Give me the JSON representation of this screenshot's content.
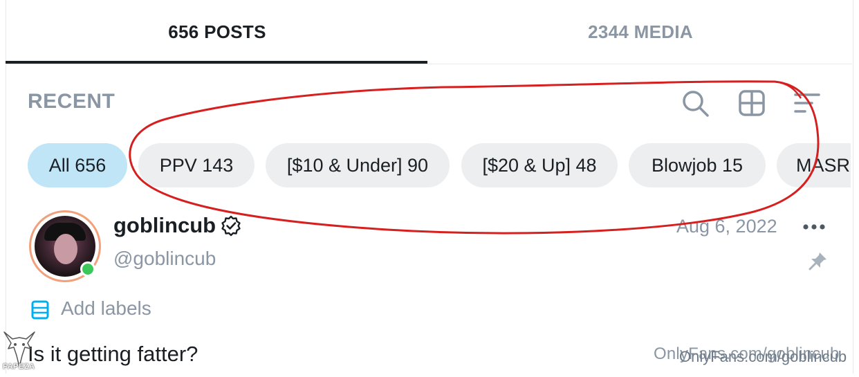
{
  "tabs": [
    {
      "label": "656 POSTS",
      "active": true
    },
    {
      "label": "2344 MEDIA",
      "active": false
    }
  ],
  "toolbar": {
    "title": "RECENT",
    "icons": [
      "search-icon",
      "grid-view-icon",
      "sort-filter-icon"
    ]
  },
  "chips": [
    {
      "label": "All 656",
      "active": true
    },
    {
      "label": "PPV 143",
      "active": false
    },
    {
      "label": "[$10 & Under] 90",
      "active": false
    },
    {
      "label": "[$20 & Up] 48",
      "active": false
    },
    {
      "label": "Blowjob 15",
      "active": false
    },
    {
      "label": "MASR",
      "active": false
    }
  ],
  "post": {
    "username": "goblincub",
    "handle": "@goblincub",
    "date": "Aug 6, 2022",
    "add_labels": "Add labels",
    "text": "Is it getting fatter?",
    "watermark": "OnlyFans.com/goblincub",
    "watermark_overlay": "OnlyFans.com/goblincub"
  },
  "logo": {
    "text": "FAPEZA"
  },
  "colors": {
    "active_chip": "#bfe5f7",
    "chip": "#eceef0",
    "muted_text": "#8a96a3",
    "primary_text": "#1a1f24",
    "online": "#3cc75a",
    "annotation": "#d61f1f",
    "accent": "#00aff0"
  }
}
